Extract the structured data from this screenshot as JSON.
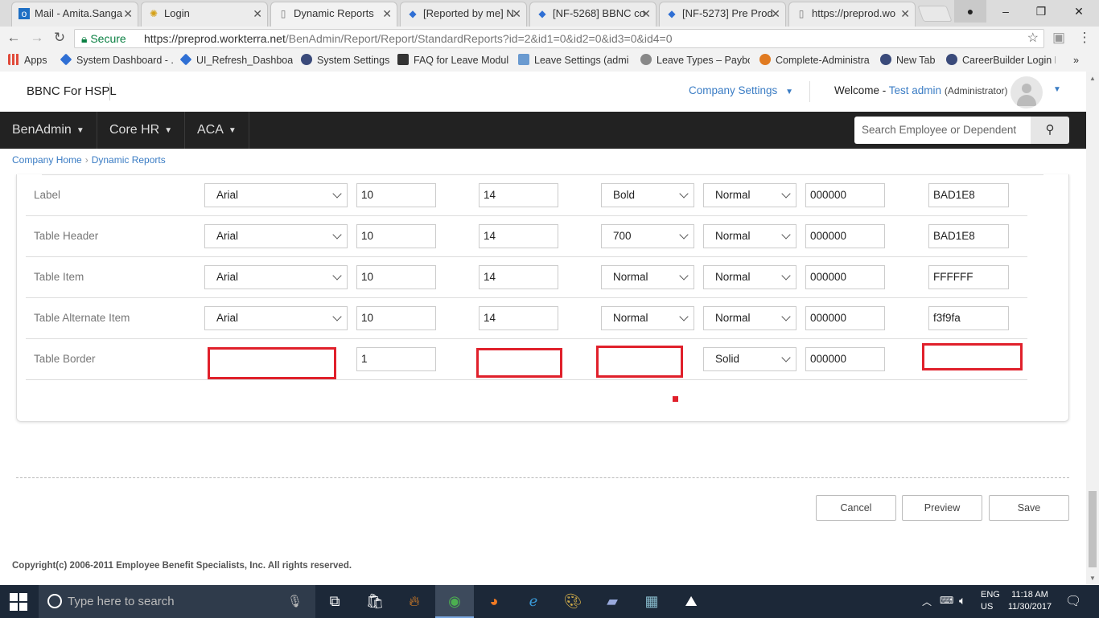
{
  "browser": {
    "tabs": [
      {
        "label": "Mail - Amita.Sanga",
        "icon": "outlook-icon",
        "active": false
      },
      {
        "label": "Login",
        "icon": "sun-icon",
        "active": false
      },
      {
        "label": "Dynamic Reports",
        "icon": "page-icon",
        "active": true
      },
      {
        "label": "[Reported by me] N",
        "icon": "jira-icon",
        "active": false
      },
      {
        "label": "[NF-5268] BBNC co",
        "icon": "jira-icon",
        "active": false
      },
      {
        "label": "[NF-5273] Pre Prod",
        "icon": "jira-icon",
        "active": false
      },
      {
        "label": "https://preprod.wo",
        "icon": "page-icon",
        "active": false
      }
    ],
    "secure_label": "Secure",
    "url_host": "https://preprod.workterra.net",
    "url_path": "/BenAdmin/Report/Report/StandardReports?id=2&id1=0&id2=0&id3=0&id4=0",
    "bookmarks": [
      {
        "label": "Apps",
        "color": "#e04a3a"
      },
      {
        "label": "System Dashboard - .",
        "color": "#2f6fd4"
      },
      {
        "label": "UI_Refresh_Dashboar",
        "color": "#2f6fd4"
      },
      {
        "label": "System Settings",
        "color": "#3a4a7a"
      },
      {
        "label": "FAQ for Leave Modul",
        "color": "#333333"
      },
      {
        "label": "Leave Settings (admi",
        "color": "#6a9ad0"
      },
      {
        "label": "Leave Types – Payboy",
        "color": "#888888"
      },
      {
        "label": "Complete-Administra",
        "color": "#e07a20"
      },
      {
        "label": "New Tab",
        "color": "#3a4a7a"
      },
      {
        "label": "CareerBuilder Login F",
        "color": "#3a4a7a"
      }
    ]
  },
  "header": {
    "brand": "BBNC For HSPL",
    "company_settings": "Company Settings",
    "welcome": "Welcome -",
    "user_name": "Test admin",
    "user_role": "(Administrator)"
  },
  "nav": {
    "items": [
      "BenAdmin",
      "Core HR",
      "ACA"
    ],
    "search_placeholder": "Search Employee or Dependent"
  },
  "breadcrumb": [
    "Company Home",
    "Dynamic Reports"
  ],
  "style_rows": [
    {
      "label": "Label",
      "font": "Arial",
      "size": "10",
      "line": "14",
      "weight": "Bold",
      "style": "Normal",
      "color": "000000",
      "bg": "BAD1E8"
    },
    {
      "label": "Table Header",
      "font": "Arial",
      "size": "10",
      "line": "14",
      "weight": "700",
      "style": "Normal",
      "color": "000000",
      "bg": "BAD1E8"
    },
    {
      "label": "Table Item",
      "font": "Arial",
      "size": "10",
      "line": "14",
      "weight": "Normal",
      "style": "Normal",
      "color": "000000",
      "bg": "FFFFFF"
    },
    {
      "label": "Table Alternate Item",
      "font": "Arial",
      "size": "10",
      "line": "14",
      "weight": "Normal",
      "style": "Normal",
      "color": "000000",
      "bg": "f3f9fa"
    }
  ],
  "border_row": {
    "label": "Table Border",
    "width": "1",
    "style": "Solid",
    "color": "000000"
  },
  "buttons": {
    "cancel": "Cancel",
    "preview": "Preview",
    "save": "Save"
  },
  "footer": {
    "copyright": "Copyright(c) 2006-2011 Employee Benefit Specialists, Inc. All rights reserved."
  },
  "taskbar": {
    "search_placeholder": "Type here to search",
    "lang_top": "ENG",
    "lang_bottom": "US",
    "time": "11:18 AM",
    "date": "11/30/2017"
  },
  "colors": {
    "accent": "#3a7cc4",
    "nav_bg": "#222222",
    "annotation_red": "#e0202b"
  }
}
